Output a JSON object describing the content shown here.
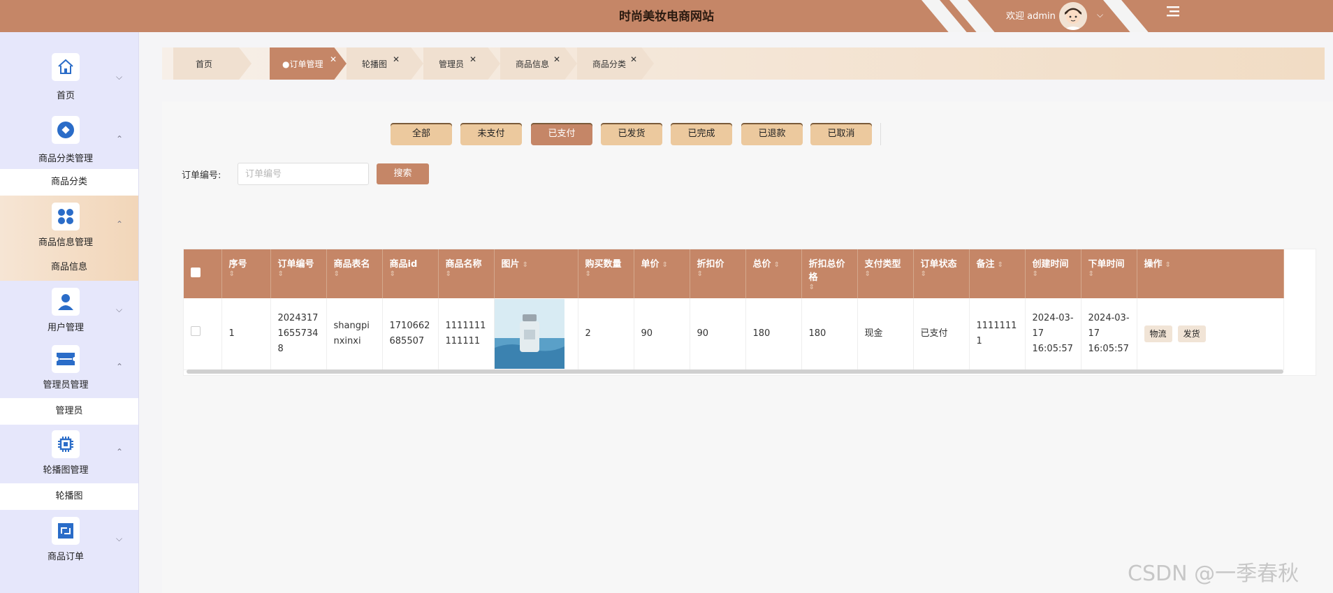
{
  "header": {
    "title": "时尚美妆电商网站",
    "welcome": "欢迎 admin"
  },
  "sidebar": {
    "groups": [
      {
        "label": "首页"
      },
      {
        "label": "商品分类管理",
        "sub": "商品分类"
      },
      {
        "label": "商品信息管理",
        "sub": "商品信息"
      },
      {
        "label": "用户管理"
      },
      {
        "label": "管理员管理",
        "sub": "管理员"
      },
      {
        "label": "轮播图管理",
        "sub": "轮播图"
      },
      {
        "label": "商品订单"
      }
    ]
  },
  "tabs": [
    "首页",
    "●订单管理",
    "轮播图",
    "管理员",
    "商品信息",
    "商品分类"
  ],
  "status_tabs": [
    "全部",
    "未支付",
    "已支付",
    "已发货",
    "已完成",
    "已退款",
    "已取消"
  ],
  "status_active": "已支付",
  "search": {
    "label": "订单编号:",
    "placeholder": "订单编号",
    "button": "搜索"
  },
  "table": {
    "columns": [
      "序号",
      "订单编号",
      "商品表名",
      "商品id",
      "商品名称",
      "图片",
      "购买数量",
      "单价",
      "折扣价",
      "总价",
      "折扣总价格",
      "支付类型",
      "订单状态",
      "备注",
      "创建时间",
      "下单时间",
      "操作"
    ],
    "sort_glyph": "⇕",
    "rows": [
      {
        "index": "1",
        "order_no": "20243171655734 8",
        "table_name": "shangpinxinxi",
        "product_id": "1710662685507",
        "product_name": "1111111111111",
        "quantity": "2",
        "price": "90",
        "discount_price": "90",
        "total": "180",
        "discount_total": "180",
        "pay_type": "现金",
        "status": "已支付",
        "remark": "11111111",
        "created": "2024-03-17 16:05:57",
        "ordered": "2024-03-17 16:05:57",
        "actions": [
          "物流",
          "发货"
        ]
      }
    ]
  },
  "watermark": "CSDN @一季春秋",
  "colors": {
    "accent": "#c58667",
    "status_button": "#ecc99e",
    "sidebar_bg": "#e6e7fb"
  }
}
